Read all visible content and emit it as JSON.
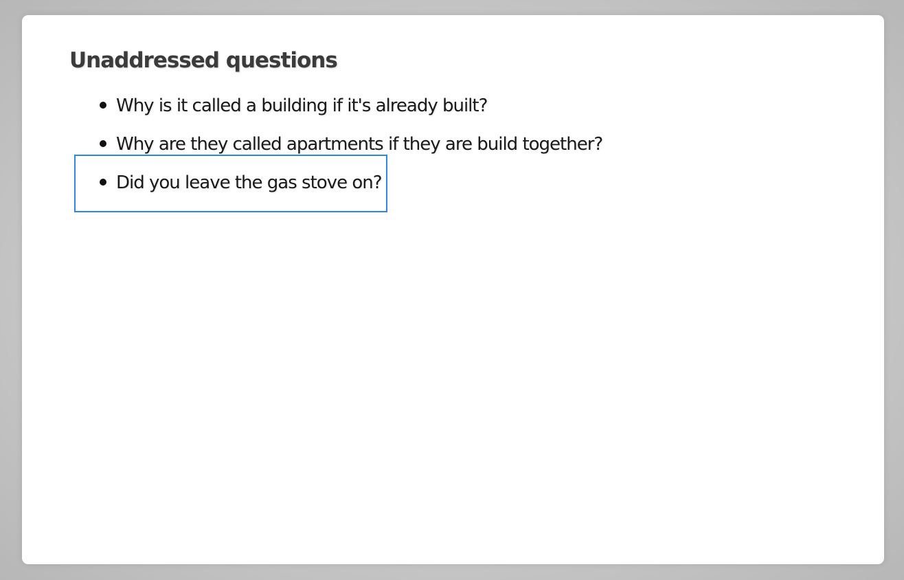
{
  "slide": {
    "title": "Unaddressed questions",
    "items": [
      {
        "text": "Why is it called a building if it's already built?"
      },
      {
        "text": "Why are they called apartments if they are build together?"
      },
      {
        "text": "Did you leave the gas stove on?"
      }
    ],
    "highlight_color": "#2b88e8",
    "highlighted_item": 3
  }
}
